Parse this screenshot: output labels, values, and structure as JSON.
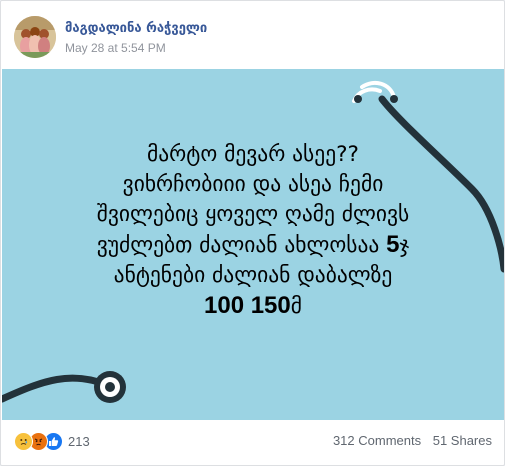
{
  "post": {
    "author": "მაგდალინა რაჭველი",
    "timestamp": "May 28 at 5:54 PM",
    "avatar_icon": "profile-photo"
  },
  "image_text": {
    "line1": "მარტო მევარ ასეე??",
    "line2": "ვიხრჩობიიი და ასეა ჩემი",
    "line3": "შვილებიც ყოველ ღამე ძლივს",
    "line4_text": "ვუძლებთ ძალიან ახლოსაა ",
    "line4_num": "5",
    "line4_unit": "ჯ",
    "line5": "ანტენები ძალიან დაბალზე",
    "line6_num": "100 150",
    "line6_unit": "მ",
    "background_color": "#9bd3e3",
    "decoration": "stethoscope-icon"
  },
  "footer": {
    "reactions": [
      "sad-reaction-icon",
      "angry-reaction-icon",
      "like-reaction-icon"
    ],
    "reaction_count": "213",
    "comments": "312 Comments",
    "shares": "51 Shares"
  }
}
